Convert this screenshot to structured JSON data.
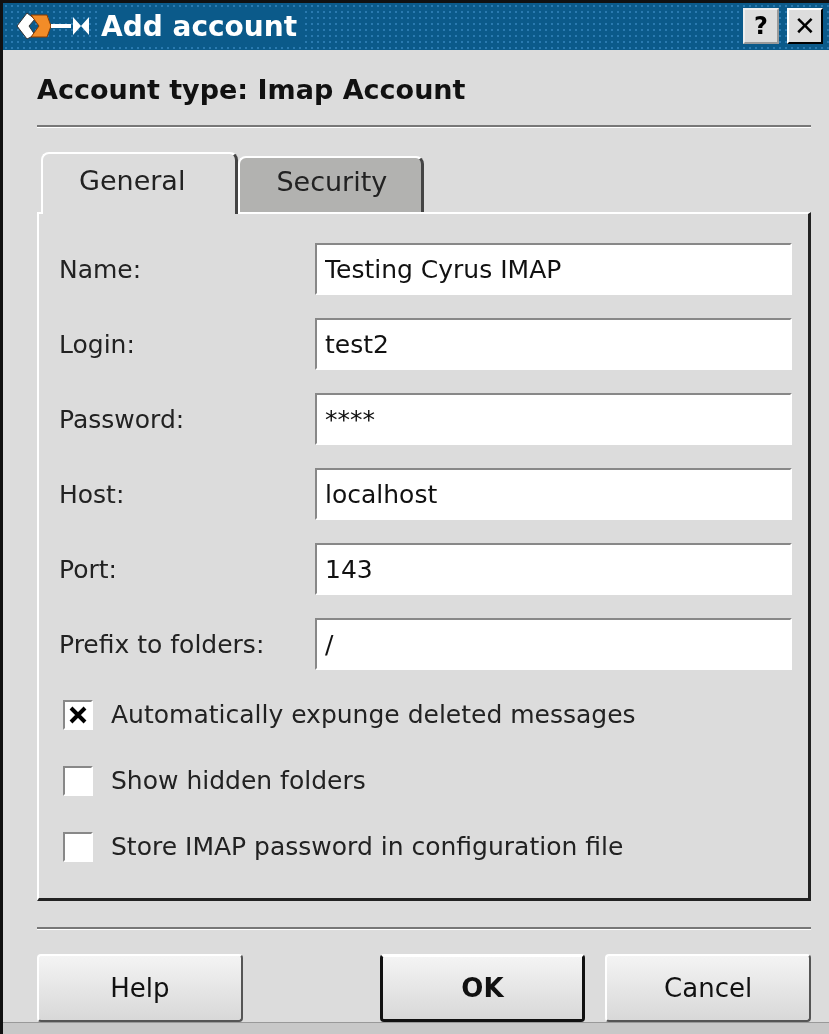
{
  "window": {
    "title": "Add account",
    "buttons": [
      {
        "kind": "help",
        "label": "?"
      },
      {
        "kind": "close",
        "label": "✕"
      }
    ]
  },
  "heading": "Account type: Imap Account",
  "tabs": [
    {
      "label": "General",
      "selected": true
    },
    {
      "label": "Security",
      "selected": false
    }
  ],
  "fields": [
    {
      "label": "Name:",
      "value": "Testing Cyrus IMAP"
    },
    {
      "label": "Login:",
      "value": "test2"
    },
    {
      "label": "Password:",
      "value": "****"
    },
    {
      "label": "Host:",
      "value": "localhost"
    },
    {
      "label": "Port:",
      "value": "143"
    },
    {
      "label": "Prefix to folders:",
      "value": "/"
    }
  ],
  "checkboxes": [
    {
      "label": "Automatically expunge deleted messages",
      "checked": true
    },
    {
      "label": "Show hidden folders",
      "checked": false
    },
    {
      "label": "Store IMAP password in configuration file",
      "checked": false
    }
  ],
  "buttons": [
    {
      "label": "Help",
      "default": false
    },
    {
      "label": "OK",
      "default": true
    },
    {
      "label": "Cancel",
      "default": false
    }
  ]
}
